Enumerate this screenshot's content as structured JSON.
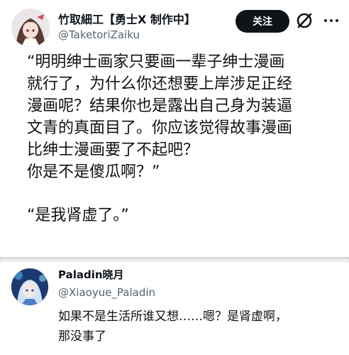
{
  "tweet1": {
    "display_name": "竹取細工【勇士X 制作中】",
    "handle": "@TaketoriZaiku",
    "follow_label": "关注",
    "lines": [
      "“明明绅士画家只要画一辈子绅士漫画",
      "就行了，为什么你还想要上岸涉足正经",
      "漫画呢？结果你也是露出自己身为装逼",
      "文青的真面目了。你应该觉得故事漫画",
      "比绅士漫画要了不起吧？",
      "你是不是傻瓜啊？”"
    ],
    "reply_line": "“是我肾虚了。”"
  },
  "tweet2": {
    "display_name": "Paladin晓月",
    "handle": "@Xiaoyue_Paladin",
    "lines": [
      "如果不是生活所谁又想……嗯？是肾虚啊，",
      "那没事了"
    ]
  },
  "colors": {
    "text": "#0f1419",
    "handle": "#536471",
    "follow_bg": "#0f1419"
  },
  "icons": {
    "logo": "x-logo-icon",
    "more": "more-options-icon"
  }
}
